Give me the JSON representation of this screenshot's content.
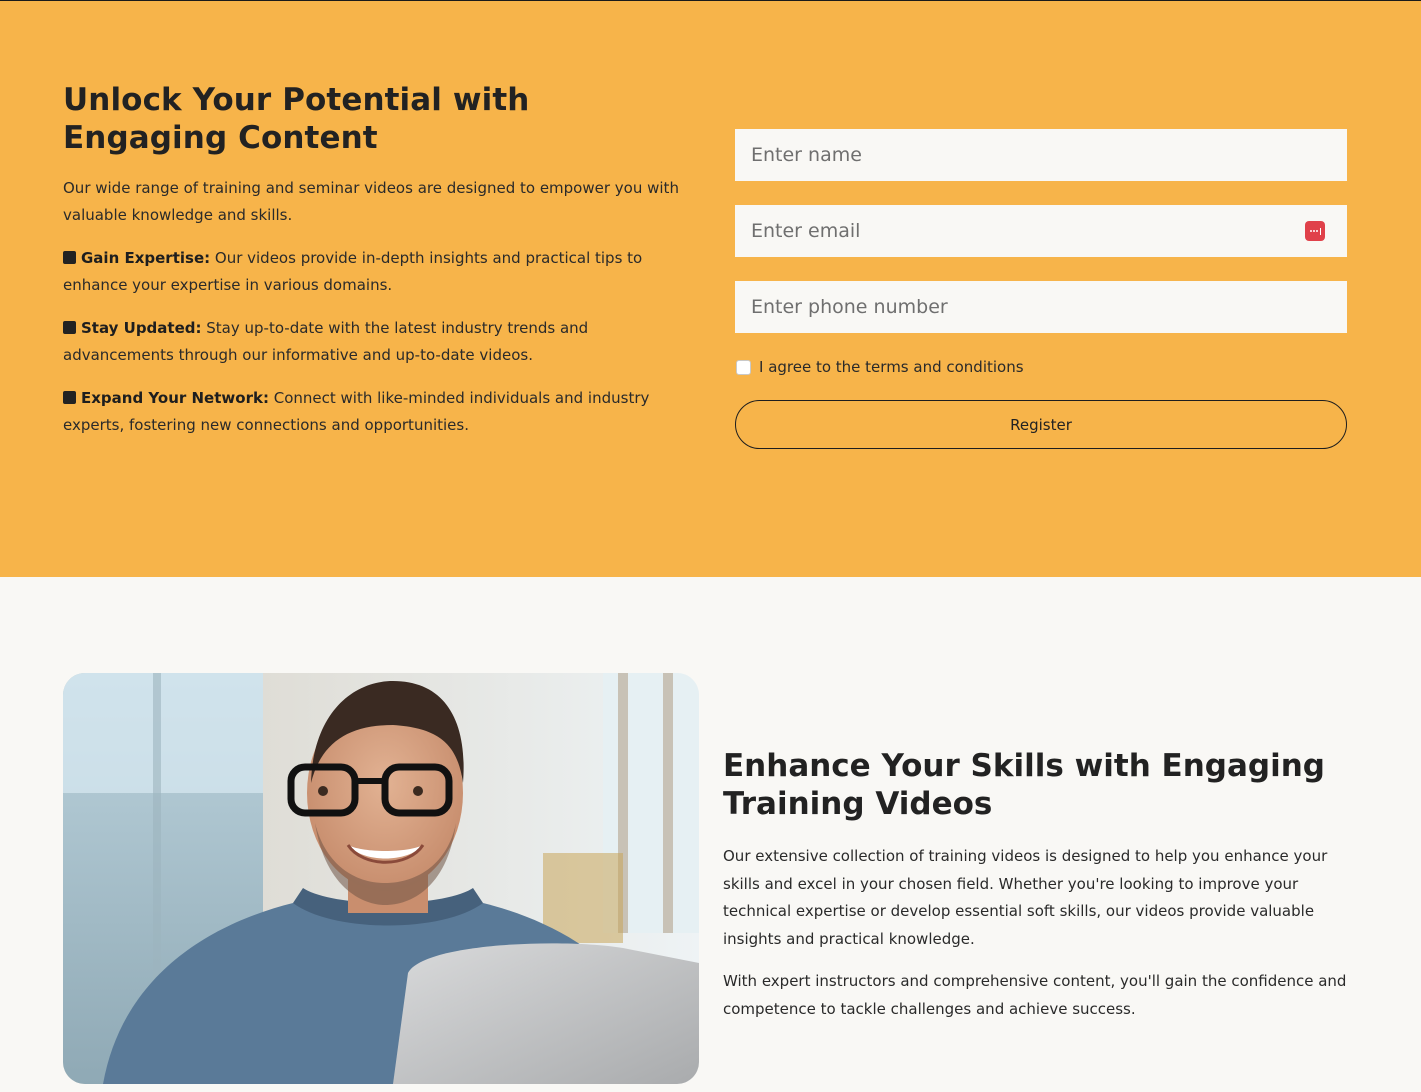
{
  "hero": {
    "title": "Unlock Your Potential with Engaging Content",
    "intro": "Our wide range of training and seminar videos are designed to empower you with valuable knowledge and skills.",
    "benefits": [
      {
        "label": "Gain Expertise:",
        "text": " Our videos provide in-depth insights and practical tips to enhance your expertise in various domains."
      },
      {
        "label": "Stay Updated:",
        "text": " Stay up-to-date with the latest industry trends and advancements through our informative and up-to-date videos."
      },
      {
        "label": "Expand Your Network:",
        "text": " Connect with like-minded individuals and industry experts, fostering new connections and opportunities."
      }
    ]
  },
  "form": {
    "name_placeholder": "Enter name",
    "email_placeholder": "Enter email",
    "phone_placeholder": "Enter phone number",
    "terms_label": "I agree to the terms and conditions",
    "terms_checked": false,
    "register_label": "Register"
  },
  "lower": {
    "title": "Enhance Your Skills with Engaging Training Videos",
    "paragraph1": "Our extensive collection of training videos is designed to help you enhance your skills and excel in your chosen field. Whether you're looking to improve your technical expertise or develop essential soft skills, our videos provide valuable insights and practical knowledge.",
    "paragraph2": "With expert instructors and comprehensive content, you'll gain the confidence and competence to tackle challenges and achieve success."
  },
  "colors": {
    "hero_bg": "#f7b44a",
    "page_bg": "#f9f8f5",
    "text": "#222222",
    "password_badge": "#e0414a"
  },
  "icons": {
    "bullet": "square-bullet-icon",
    "email_field": "password-manager-icon"
  }
}
